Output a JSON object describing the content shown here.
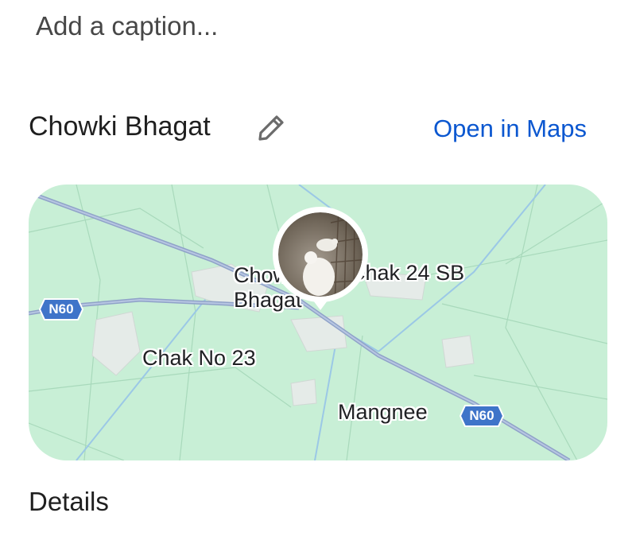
{
  "caption": {
    "placeholder": "Add a caption..."
  },
  "location": {
    "name": "Chowki Bhagat",
    "edit_icon": "pencil-icon",
    "open_maps_label": "Open in Maps",
    "link_color": "#0b57d0"
  },
  "map": {
    "background_color": "#c8efd6",
    "road_color": "#8fa2c8",
    "labels": {
      "chowki_line1": "Chowki",
      "chowki_line2": "Bhagat",
      "chak24": "Chak 24 SB",
      "chakno23": "Chak No 23",
      "mangnee": "Mangnee"
    },
    "shields": {
      "left": "N60",
      "right": "N60"
    },
    "shield_color": "#3f74c9"
  },
  "details": {
    "heading": "Details"
  }
}
